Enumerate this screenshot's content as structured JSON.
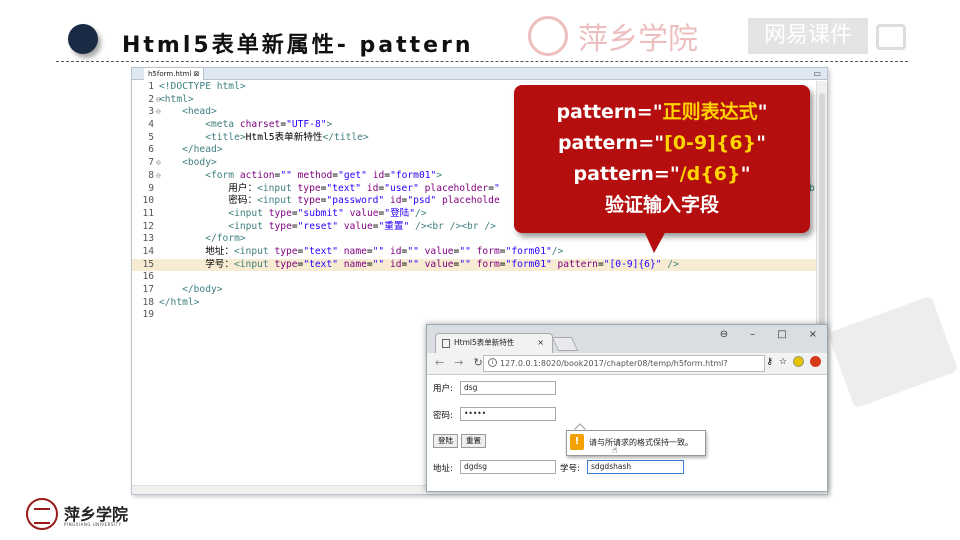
{
  "slide": {
    "title": "Html5表单新属性- pattern",
    "watermark_school": "萍乡学院",
    "watermark_tag": "网易课件"
  },
  "editor": {
    "tab_label": "h5form.html ⊠",
    "lines": [
      {
        "n": "1",
        "fold": "",
        "segs": [
          {
            "c": "tag",
            "t": "<!DOCTYPE html>"
          }
        ]
      },
      {
        "n": "2",
        "fold": "⊖",
        "segs": [
          {
            "c": "tag",
            "t": "<html>"
          }
        ]
      },
      {
        "n": "3",
        "fold": "⊖",
        "segs": [
          {
            "c": "tag",
            "t": "    <head>"
          }
        ]
      },
      {
        "n": "4",
        "fold": "",
        "segs": [
          {
            "c": "tag",
            "t": "        <meta "
          },
          {
            "c": "kw",
            "t": "charset"
          },
          {
            "c": "pl",
            "t": "="
          },
          {
            "c": "str",
            "t": "\"UTF-8\""
          },
          {
            "c": "tag",
            "t": ">"
          }
        ]
      },
      {
        "n": "5",
        "fold": "",
        "segs": [
          {
            "c": "tag",
            "t": "        <title>"
          },
          {
            "c": "pl",
            "t": "Html5表单新特性"
          },
          {
            "c": "tag",
            "t": "</title>"
          }
        ]
      },
      {
        "n": "6",
        "fold": "",
        "segs": [
          {
            "c": "tag",
            "t": "    </head>"
          }
        ]
      },
      {
        "n": "7",
        "fold": "⊖",
        "segs": [
          {
            "c": "tag",
            "t": "    <body>"
          }
        ]
      },
      {
        "n": "8",
        "fold": "⊖",
        "segs": [
          {
            "c": "tag",
            "t": "        <form "
          },
          {
            "c": "kw",
            "t": "action"
          },
          {
            "c": "pl",
            "t": "="
          },
          {
            "c": "str",
            "t": "\"\" "
          },
          {
            "c": "kw",
            "t": "method"
          },
          {
            "c": "pl",
            "t": "="
          },
          {
            "c": "str",
            "t": "\"get\" "
          },
          {
            "c": "kw",
            "t": "id"
          },
          {
            "c": "pl",
            "t": "="
          },
          {
            "c": "str",
            "t": "\"form01\""
          },
          {
            "c": "tag",
            "t": ">"
          }
        ]
      },
      {
        "n": "9",
        "fold": "",
        "segs": [
          {
            "c": "pl",
            "t": "            用户："
          },
          {
            "c": "tag",
            "t": "<input "
          },
          {
            "c": "kw",
            "t": "type"
          },
          {
            "c": "pl",
            "t": "="
          },
          {
            "c": "str",
            "t": "\"text\" "
          },
          {
            "c": "kw",
            "t": "id"
          },
          {
            "c": "pl",
            "t": "="
          },
          {
            "c": "str",
            "t": "\"user\" "
          },
          {
            "c": "kw",
            "t": "placeholder"
          },
          {
            "c": "pl",
            "t": "="
          },
          {
            "c": "str",
            "t": "\""
          }
        ]
      },
      {
        "n": "10",
        "fold": "",
        "segs": [
          {
            "c": "pl",
            "t": "            密码："
          },
          {
            "c": "tag",
            "t": "<input "
          },
          {
            "c": "kw",
            "t": "type"
          },
          {
            "c": "pl",
            "t": "="
          },
          {
            "c": "str",
            "t": "\"password\" "
          },
          {
            "c": "kw",
            "t": "id"
          },
          {
            "c": "pl",
            "t": "="
          },
          {
            "c": "str",
            "t": "\"psd\" "
          },
          {
            "c": "kw",
            "t": "placeholde"
          }
        ]
      },
      {
        "n": "11",
        "fold": "",
        "segs": [
          {
            "c": "tag",
            "t": "            <input "
          },
          {
            "c": "kw",
            "t": "type"
          },
          {
            "c": "pl",
            "t": "="
          },
          {
            "c": "str",
            "t": "\"submit\" "
          },
          {
            "c": "kw",
            "t": "value"
          },
          {
            "c": "pl",
            "t": "="
          },
          {
            "c": "str",
            "t": "\"登陆\""
          },
          {
            "c": "tag",
            "t": "/>"
          }
        ]
      },
      {
        "n": "12",
        "fold": "",
        "segs": [
          {
            "c": "tag",
            "t": "            <input "
          },
          {
            "c": "kw",
            "t": "type"
          },
          {
            "c": "pl",
            "t": "="
          },
          {
            "c": "str",
            "t": "\"reset\" "
          },
          {
            "c": "kw",
            "t": "value"
          },
          {
            "c": "pl",
            "t": "="
          },
          {
            "c": "str",
            "t": "\"重置\" "
          },
          {
            "c": "tag",
            "t": "/><br /><br />"
          }
        ]
      },
      {
        "n": "13",
        "fold": "",
        "segs": [
          {
            "c": "tag",
            "t": "        </form>"
          }
        ]
      },
      {
        "n": "14",
        "fold": "",
        "segs": [
          {
            "c": "pl",
            "t": "        地址："
          },
          {
            "c": "tag",
            "t": "<input "
          },
          {
            "c": "kw",
            "t": "type"
          },
          {
            "c": "pl",
            "t": "="
          },
          {
            "c": "str",
            "t": "\"text\" "
          },
          {
            "c": "kw",
            "t": "name"
          },
          {
            "c": "pl",
            "t": "="
          },
          {
            "c": "str",
            "t": "\"\" "
          },
          {
            "c": "kw",
            "t": "id"
          },
          {
            "c": "pl",
            "t": "="
          },
          {
            "c": "str",
            "t": "\"\" "
          },
          {
            "c": "kw",
            "t": "value"
          },
          {
            "c": "pl",
            "t": "="
          },
          {
            "c": "str",
            "t": "\"\" "
          },
          {
            "c": "kw",
            "t": "form"
          },
          {
            "c": "pl",
            "t": "="
          },
          {
            "c": "str",
            "t": "\"form01\""
          },
          {
            "c": "tag",
            "t": "/>"
          }
        ]
      },
      {
        "n": "15",
        "fold": "",
        "hl": true,
        "segs": [
          {
            "c": "pl",
            "t": "        学号："
          },
          {
            "c": "tag",
            "t": "<input "
          },
          {
            "c": "kw",
            "t": "type"
          },
          {
            "c": "pl",
            "t": "="
          },
          {
            "c": "str",
            "t": "\"text\" "
          },
          {
            "c": "kw",
            "t": "name"
          },
          {
            "c": "pl",
            "t": "="
          },
          {
            "c": "str",
            "t": "\"\" "
          },
          {
            "c": "kw",
            "t": "id"
          },
          {
            "c": "pl",
            "t": "="
          },
          {
            "c": "str",
            "t": "\"\" "
          },
          {
            "c": "kw",
            "t": "value"
          },
          {
            "c": "pl",
            "t": "="
          },
          {
            "c": "str",
            "t": "\"\" "
          },
          {
            "c": "kw",
            "t": "form"
          },
          {
            "c": "pl",
            "t": "="
          },
          {
            "c": "str",
            "t": "\"form01\" "
          },
          {
            "c": "kw",
            "t": "pattern"
          },
          {
            "c": "pl",
            "t": "="
          },
          {
            "c": "str",
            "t": "\"[0-9]{6}\" "
          },
          {
            "c": "tag",
            "t": "/>"
          }
        ]
      },
      {
        "n": "16",
        "fold": "",
        "segs": []
      },
      {
        "n": "17",
        "fold": "",
        "segs": [
          {
            "c": "tag",
            "t": "    </body>"
          }
        ]
      },
      {
        "n": "18",
        "fold": "",
        "segs": [
          {
            "c": "tag",
            "t": "</html>"
          }
        ]
      },
      {
        "n": "19",
        "fold": "",
        "segs": []
      }
    ],
    "clipped_char": "b"
  },
  "callout": {
    "line1_a": "pattern=\"",
    "line1_b": "正则表达式",
    "line1_c": "\"",
    "line2_a": "pattern=\"",
    "line2_b": "[0-9]{6}",
    "line2_c": "\"",
    "line3_a": "pattern=\"",
    "line3_b": "/d{6}",
    "line3_c": "\"",
    "line4": "验证输入字段"
  },
  "browser": {
    "tab_title": "Html5表单新特性",
    "tab_close": "×",
    "url": "127.0.0.1:8020/book2017/chapter08/temp/h5form.html?",
    "win_controls": [
      "⊖",
      "–",
      "□",
      "×"
    ],
    "form": {
      "user_label": "用户:",
      "user_value": "dsg",
      "psd_label": "密码:",
      "psd_value": "•••••",
      "submit_label": "登陆",
      "reset_label": "重置",
      "address_label": "地址:",
      "address_value": "dgdsg",
      "student_label": "学号:",
      "student_value": "sdgdshash"
    },
    "tooltip_text": "请与所请求的格式保持一致。",
    "tooltip_icon": "!"
  },
  "footer": {
    "school_name": "萍乡学院",
    "school_en": "PINGXIANG UNIVERSITY"
  },
  "colors": {
    "callout_bg": "#b50e0e",
    "callout_highlight": "#ffd400",
    "title_dot": "#1b2a44",
    "code_tag": "#3f7f7f",
    "code_attr": "#7f007f",
    "code_string": "#2a00ff",
    "line_highlight": "#f7ecd2"
  }
}
